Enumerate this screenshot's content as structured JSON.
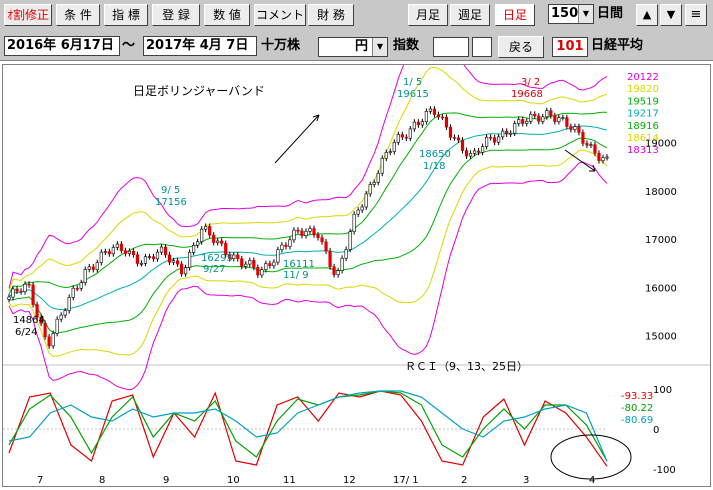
{
  "toolbar": {
    "buttons": [
      {
        "label": "ｵ割修正",
        "red": true
      },
      {
        "label": "条 件",
        "red": false
      },
      {
        "label": "指 標",
        "red": false
      },
      {
        "label": "登 録",
        "red": false
      },
      {
        "label": "数 値",
        "red": false
      },
      {
        "label": "コメント",
        "red": false
      },
      {
        "label": "財 務",
        "red": false
      }
    ],
    "period_buttons": [
      {
        "label": "月足",
        "active": false
      },
      {
        "label": "週足",
        "active": false
      },
      {
        "label": "日足",
        "active": true
      }
    ],
    "days_value": "150",
    "days_label": "日間",
    "up_icon": "up-arrow-icon",
    "down_icon": "down-arrow-icon",
    "menu_icon": "menu-icon"
  },
  "rangebar": {
    "start_date": "2016年 6月17日",
    "tilde": "～",
    "end_date": "2017年 4月 7日",
    "volume_unit": "十万株",
    "currency_value": "円",
    "index_label": "指数",
    "back_label": "戻る",
    "code": "101",
    "name": "日経平均"
  },
  "chart": {
    "title": "日足ボリンジャーバンド",
    "band_labels": [
      {
        "text": "20122",
        "color": "#e000e0"
      },
      {
        "text": "19820",
        "color": "#d8d800"
      },
      {
        "text": "19519",
        "color": "#00b000"
      },
      {
        "text": "19217",
        "color": "#00b0b0"
      },
      {
        "text": "18916",
        "color": "#00b000"
      },
      {
        "text": "18614",
        "color": "#d8d800"
      },
      {
        "text": "18313",
        "color": "#e000e0"
      }
    ],
    "price_ticks": [
      "19000",
      "18000",
      "17000",
      "16000",
      "15000"
    ],
    "annotations": [
      {
        "text": "14864",
        "color": "#000000"
      },
      {
        "text": "6/24",
        "color": "#000000"
      },
      {
        "text": "9/ 5",
        "color": "#009090"
      },
      {
        "text": "17156",
        "color": "#009090"
      },
      {
        "text": "16295",
        "color": "#009090"
      },
      {
        "text": "9/27",
        "color": "#009090"
      },
      {
        "text": "16111",
        "color": "#009090"
      },
      {
        "text": "11/ 9",
        "color": "#009090"
      },
      {
        "text": "1/ 5",
        "color": "#009090"
      },
      {
        "text": "19615",
        "color": "#009090"
      },
      {
        "text": "18650",
        "color": "#009090"
      },
      {
        "text": "1/18",
        "color": "#009090"
      },
      {
        "text": "3/ 2",
        "color": "#e00000"
      },
      {
        "text": "19668",
        "color": "#e00000"
      }
    ],
    "rci_title": "ＲＣＩ（9、13、25日）",
    "rci_values": [
      {
        "text": "-93.33",
        "color": "#e00000"
      },
      {
        "text": "-80.22",
        "color": "#00a000"
      },
      {
        "text": "-80.69",
        "color": "#00a0c0"
      }
    ],
    "rci_ticks": [
      "100",
      "0",
      "-100"
    ],
    "month_labels": [
      "7",
      "8",
      "9",
      "10",
      "11",
      "12",
      "17/ 1",
      "2",
      "3",
      "4"
    ]
  },
  "chart_data": {
    "type": "line",
    "price_ylim": [
      14600,
      20400
    ],
    "rci_ylim": [
      -115,
      115
    ],
    "months": [
      "7",
      "8",
      "9",
      "10",
      "11",
      "12",
      "17/ 1",
      "2",
      "3",
      "4"
    ],
    "close_anchors": [
      15800,
      16000,
      14864,
      15600,
      16400,
      16700,
      16800,
      16550,
      16700,
      16400,
      17156,
      16900,
      16500,
      16295,
      16800,
      17100,
      17200,
      16111,
      17600,
      18300,
      19000,
      19400,
      19615,
      19200,
      18650,
      19100,
      19300,
      19450,
      19668,
      19300,
      19000,
      18600
    ],
    "rci_series": [
      {
        "name": "9",
        "color": "#e00000",
        "values": [
          -60,
          80,
          90,
          -40,
          -80,
          70,
          85,
          -70,
          40,
          -20,
          90,
          -80,
          -90,
          60,
          80,
          20,
          90,
          80,
          95,
          85,
          20,
          -80,
          -90,
          30,
          75,
          -40,
          70,
          40,
          -20,
          -93.33
        ]
      },
      {
        "name": "13",
        "color": "#00a000",
        "values": [
          -40,
          50,
          85,
          30,
          -60,
          30,
          80,
          -20,
          40,
          20,
          70,
          -30,
          -70,
          20,
          75,
          60,
          80,
          85,
          95,
          90,
          60,
          -40,
          -70,
          0,
          50,
          0,
          60,
          60,
          10,
          -80.22
        ]
      },
      {
        "name": "25",
        "color": "#00a0c0",
        "values": [
          -30,
          -20,
          40,
          60,
          30,
          20,
          50,
          30,
          40,
          40,
          50,
          20,
          -20,
          -10,
          40,
          60,
          80,
          90,
          95,
          95,
          80,
          40,
          0,
          -20,
          20,
          30,
          50,
          60,
          40,
          -80.69
        ]
      }
    ]
  }
}
